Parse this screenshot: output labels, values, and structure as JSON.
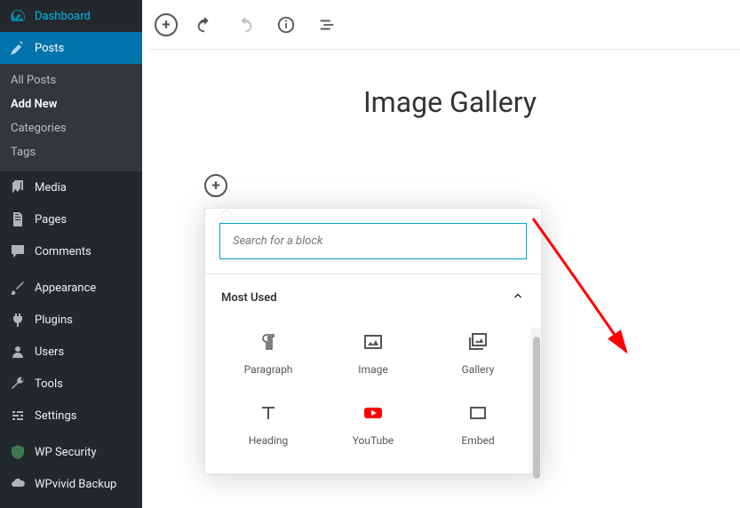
{
  "sidebar": {
    "dashboard": "Dashboard",
    "posts": "Posts",
    "posts_sub": {
      "all": "All Posts",
      "add": "Add New",
      "cats": "Categories",
      "tags": "Tags"
    },
    "media": "Media",
    "pages": "Pages",
    "comments": "Comments",
    "appearance": "Appearance",
    "plugins": "Plugins",
    "users": "Users",
    "tools": "Tools",
    "settings": "Settings",
    "wpsec": "WP Security",
    "wpvivid": "WPvivid Backup"
  },
  "editor": {
    "title": "Image Gallery",
    "search_placeholder": "Search for a block",
    "panel_title": "Most Used",
    "blocks": {
      "paragraph": "Paragraph",
      "image": "Image",
      "gallery": "Gallery",
      "heading": "Heading",
      "youtube": "YouTube",
      "embed": "Embed"
    }
  }
}
